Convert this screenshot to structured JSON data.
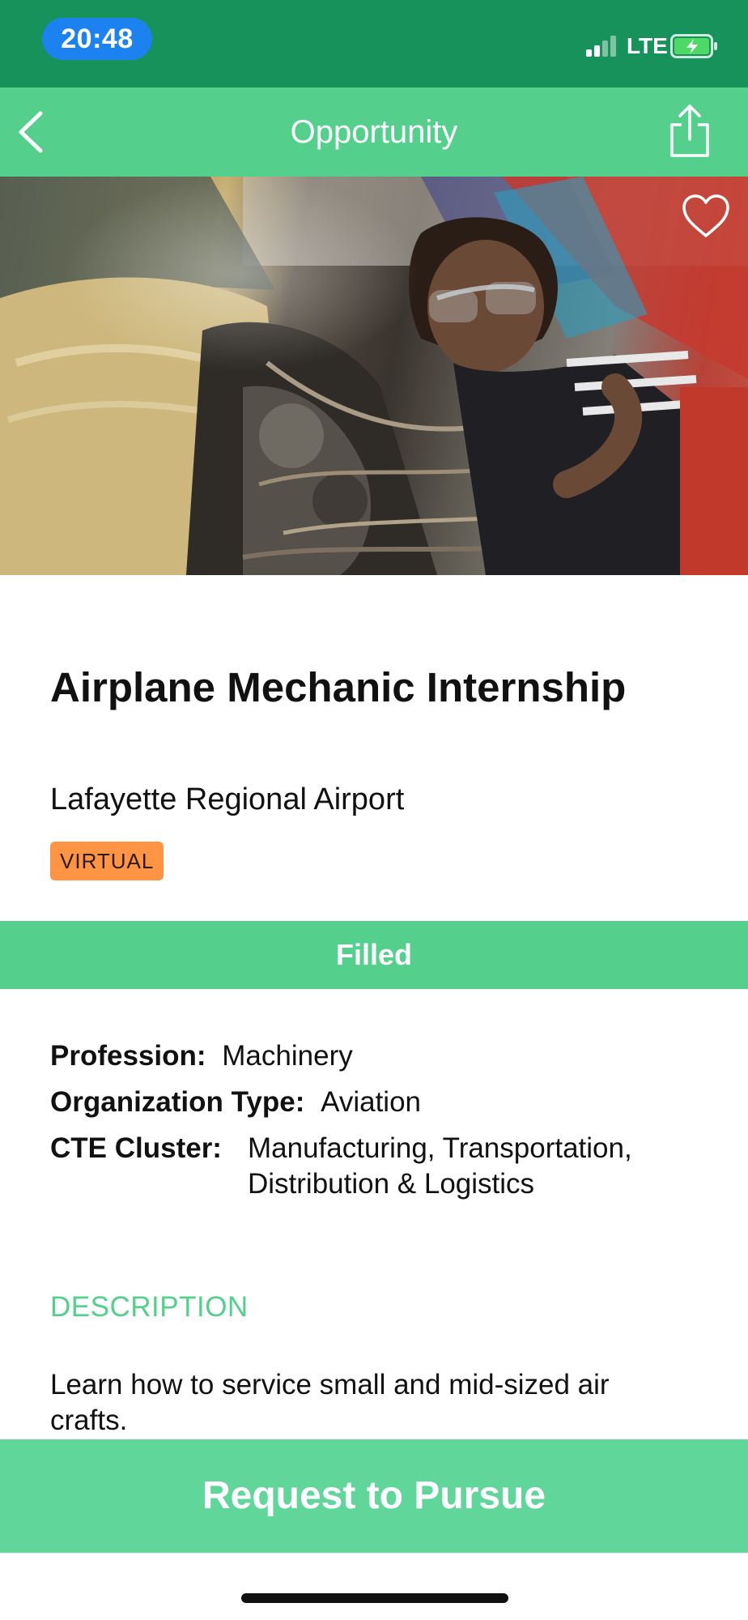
{
  "status_bar": {
    "time": "20:48",
    "network": "LTE",
    "battery_state": "charging",
    "colors": {
      "background": "#17925b",
      "time_pill": "#1b82f0"
    }
  },
  "nav": {
    "title": "Opportunity",
    "back_icon": "chevron-left-icon",
    "share_icon": "share-icon"
  },
  "hero": {
    "favorite_icon": "heart-outline-icon"
  },
  "opportunity": {
    "title": "Airplane Mechanic Internship",
    "organization": "Lafayette Regional Airport",
    "badge": "VIRTUAL",
    "status": "Filled"
  },
  "details": {
    "profession_label": "Profession:",
    "profession_value": "Machinery",
    "org_type_label": "Organization Type:",
    "org_type_value": "Aviation",
    "cte_label": "CTE Cluster:",
    "cte_value": "Manufacturing, Transportation, Distribution & Logistics"
  },
  "description": {
    "heading": "DESCRIPTION",
    "text": "Learn how to service small and mid-sized air crafts."
  },
  "cta": {
    "label": "Request to Pursue"
  },
  "colors": {
    "accent": "#54d08c",
    "cta": "#61d69a",
    "badge": "#ff9444"
  }
}
